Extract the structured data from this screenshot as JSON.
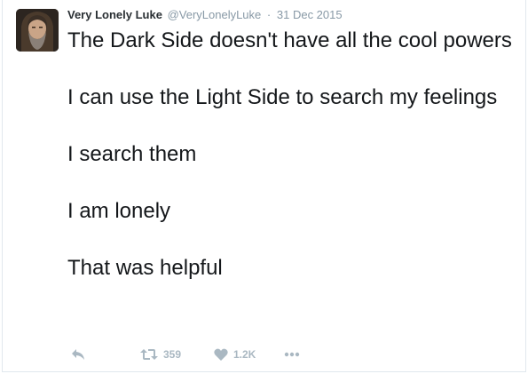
{
  "tweet": {
    "author": {
      "display_name": "Very Lonely Luke",
      "screen_name": "@VeryLonelyLuke",
      "avatar_icon": "bearded-man-avatar"
    },
    "separator": "·",
    "timestamp": "31 Dec 2015",
    "paragraphs": [
      "The Dark Side doesn't have all the cool powers",
      "I can use the Light Side to search my feelings",
      "I search them",
      "I am lonely",
      "That was helpful"
    ],
    "actions": {
      "reply_icon": "reply-icon",
      "retweet_icon": "retweet-icon",
      "retweet_count": "359",
      "like_icon": "heart-icon",
      "like_count": "1.2K",
      "more_icon": "more-dots-icon"
    }
  },
  "colors": {
    "name": "#292f33",
    "meta": "#8899a6",
    "text": "#14171a",
    "action": "#aab8c2",
    "border": "#e1e8ed"
  }
}
